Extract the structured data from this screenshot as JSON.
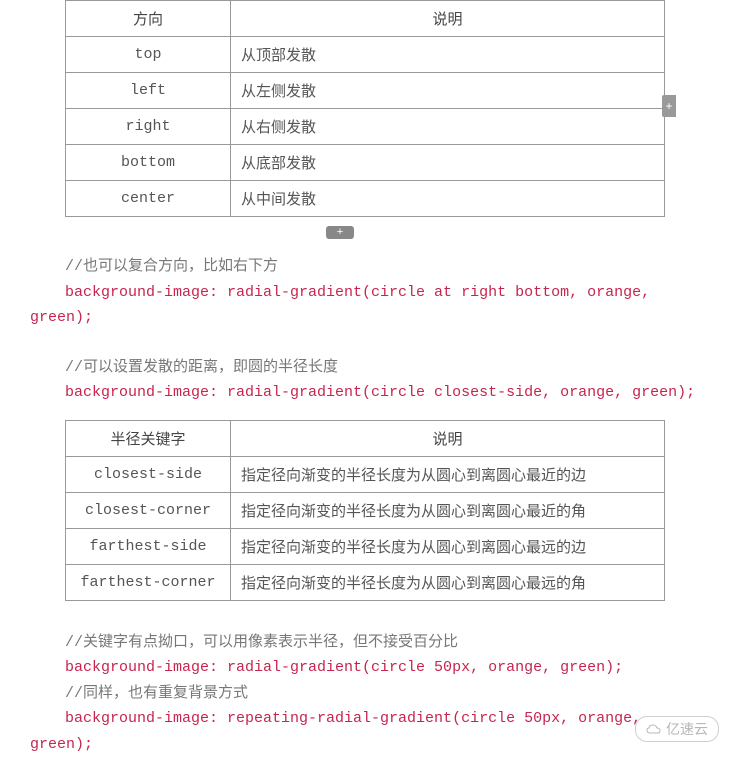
{
  "table1": {
    "headers": [
      "方向",
      "说明"
    ],
    "rows": [
      [
        "top",
        "从顶部发散"
      ],
      [
        "left",
        "从左侧发散"
      ],
      [
        "right",
        "从右侧发散"
      ],
      [
        "bottom",
        "从底部发散"
      ],
      [
        "center",
        "从中间发散"
      ]
    ]
  },
  "comment1": "//也可以复合方向，比如右下方",
  "code1_line1": "  background-image: radial-gradient(circle at right bottom, orange,",
  "code1_line2": "green);",
  "comment2": "//可以设置发散的距离，即圆的半径长度",
  "code2": "  background-image: radial-gradient(circle closest-side, orange, green);",
  "table2": {
    "headers": [
      "半径关键字",
      "说明"
    ],
    "rows": [
      [
        "closest-side",
        "指定径向渐变的半径长度为从圆心到离圆心最近的边"
      ],
      [
        "closest-corner",
        "指定径向渐变的半径长度为从圆心到离圆心最近的角"
      ],
      [
        "farthest-side",
        "指定径向渐变的半径长度为从圆心到离圆心最远的边"
      ],
      [
        "farthest-corner",
        "指定径向渐变的半径长度为从圆心到离圆心最远的角"
      ]
    ]
  },
  "comment3": "//关键字有点拗口，可以用像素表示半径，但不接受百分比",
  "code3": "  background-image: radial-gradient(circle 50px, orange, green);",
  "comment4": "//同样，也有重复背景方式",
  "code4_line1": "  background-image: repeating-radial-gradient(circle 50px, orange,",
  "code4_line2": "green);",
  "controls": {
    "plus": "+"
  },
  "watermark": "亿速云"
}
